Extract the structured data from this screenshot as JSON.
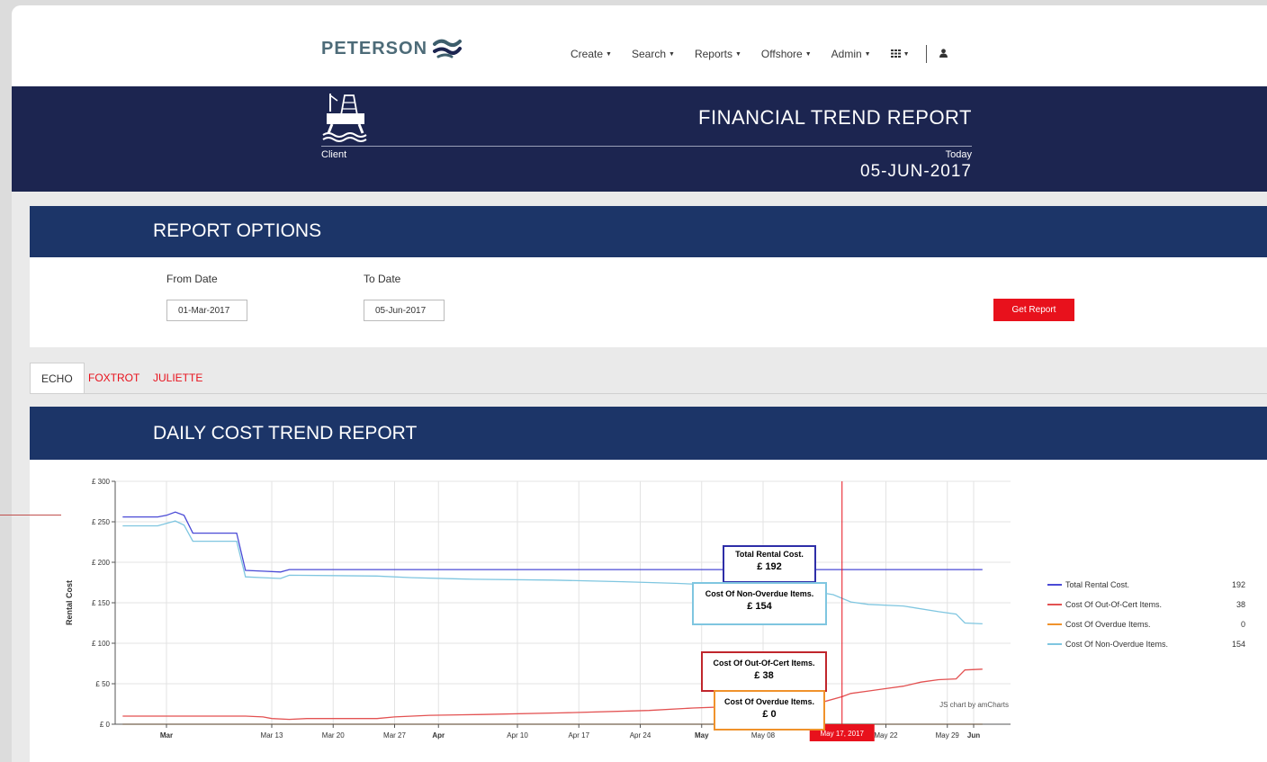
{
  "header": {
    "logo_text": "PETERSON",
    "nav": [
      {
        "label": "Create"
      },
      {
        "label": "Search"
      },
      {
        "label": "Reports"
      },
      {
        "label": "Offshore"
      },
      {
        "label": "Admin"
      }
    ]
  },
  "banner": {
    "client_label": "Client",
    "title": "FINANCIAL TREND REPORT",
    "today_label": "Today",
    "today_date": "05-JUN-2017"
  },
  "report_options": {
    "title": "REPORT OPTIONS",
    "from_label": "From Date",
    "from_value": "01-Mar-2017",
    "to_label": "To Date",
    "to_value": "05-Jun-2017",
    "button_label": "Get Report"
  },
  "tabs": [
    {
      "label": "ECHO",
      "active": true
    },
    {
      "label": "FOXTROT",
      "active": false
    },
    {
      "label": "JULIETTE",
      "active": false
    }
  ],
  "chart_section": {
    "title": "DAILY COST TREND REPORT",
    "credit": "JS chart by amCharts"
  },
  "tooltips": [
    {
      "label": "Total Rental Cost.",
      "value": "£ 192"
    },
    {
      "label": "Cost Of Non-Overdue Items.",
      "value": "£ 154"
    },
    {
      "label": "Cost Of Out-Of-Cert Items.",
      "value": "£ 38"
    },
    {
      "label": "Cost Of Overdue Items.",
      "value": "£ 0"
    }
  ],
  "chart_data": {
    "type": "line",
    "ylabel": "Rental Cost",
    "ylim": [
      0,
      300
    ],
    "yticks": [
      "£ 0",
      "£ 50",
      "£ 100",
      "£ 150",
      "£ 200",
      "£ 250",
      "£ 300"
    ],
    "xticks": [
      {
        "day": 0,
        "label": "Mar",
        "bold": true
      },
      {
        "day": 12,
        "label": "Mar 13",
        "bold": false
      },
      {
        "day": 19,
        "label": "Mar 20",
        "bold": false
      },
      {
        "day": 26,
        "label": "Mar 27",
        "bold": false
      },
      {
        "day": 31,
        "label": "Apr",
        "bold": true
      },
      {
        "day": 40,
        "label": "Apr 10",
        "bold": false
      },
      {
        "day": 47,
        "label": "Apr 17",
        "bold": false
      },
      {
        "day": 54,
        "label": "Apr 24",
        "bold": false
      },
      {
        "day": 61,
        "label": "May",
        "bold": true
      },
      {
        "day": 68,
        "label": "May 08",
        "bold": false
      },
      {
        "day": 82,
        "label": "May 22",
        "bold": false
      },
      {
        "day": 89,
        "label": "May 29",
        "bold": false
      },
      {
        "day": 92,
        "label": "Jun",
        "bold": true
      }
    ],
    "cursor": {
      "day": 77,
      "label": "May 17, 2017"
    },
    "grid": true,
    "legend_position": "right",
    "series": [
      {
        "name": "Total Rental Cost.",
        "color": "#4a4ad6",
        "legend_value": "192",
        "points": [
          [
            -5,
            256
          ],
          [
            -1,
            256
          ],
          [
            0,
            258
          ],
          [
            1,
            262
          ],
          [
            2,
            258
          ],
          [
            3,
            236
          ],
          [
            8,
            236
          ],
          [
            9,
            190
          ],
          [
            11,
            189
          ],
          [
            13,
            188
          ],
          [
            14,
            191
          ],
          [
            93,
            191
          ]
        ]
      },
      {
        "name": "Cost Of Out-Of-Cert Items.",
        "color": "#e35252",
        "legend_value": "38",
        "points": [
          [
            -5,
            10
          ],
          [
            9,
            10
          ],
          [
            11,
            9
          ],
          [
            12,
            7
          ],
          [
            14,
            6
          ],
          [
            16,
            7
          ],
          [
            24,
            7
          ],
          [
            26,
            9
          ],
          [
            30,
            11
          ],
          [
            36,
            12
          ],
          [
            45,
            14
          ],
          [
            55,
            17
          ],
          [
            60,
            20
          ],
          [
            65,
            22
          ],
          [
            70,
            25
          ],
          [
            75,
            28
          ],
          [
            77,
            34
          ],
          [
            78,
            38
          ],
          [
            80,
            41
          ],
          [
            82,
            44
          ],
          [
            84,
            47
          ],
          [
            86,
            52
          ],
          [
            88,
            55
          ],
          [
            90,
            56
          ],
          [
            91,
            67
          ],
          [
            93,
            68
          ]
        ]
      },
      {
        "name": "Cost Of Overdue Items.",
        "color": "#f0922b",
        "legend_value": "0",
        "points": [
          [
            -5,
            0
          ],
          [
            93,
            0
          ]
        ]
      },
      {
        "name": "Cost Of Non-Overdue Items.",
        "color": "#7fc6e0",
        "legend_value": "154",
        "points": [
          [
            -5,
            245
          ],
          [
            -1,
            245
          ],
          [
            0,
            248
          ],
          [
            1,
            251
          ],
          [
            2,
            246
          ],
          [
            3,
            226
          ],
          [
            8,
            226
          ],
          [
            9,
            182
          ],
          [
            11,
            181
          ],
          [
            13,
            180
          ],
          [
            14,
            184
          ],
          [
            24,
            183
          ],
          [
            28,
            181
          ],
          [
            35,
            179
          ],
          [
            44,
            178
          ],
          [
            52,
            176
          ],
          [
            58,
            174
          ],
          [
            65,
            171
          ],
          [
            72,
            167
          ],
          [
            76,
            160
          ],
          [
            78,
            151
          ],
          [
            80,
            148
          ],
          [
            84,
            146
          ],
          [
            88,
            139
          ],
          [
            90,
            136
          ],
          [
            91,
            125
          ],
          [
            93,
            124
          ]
        ]
      }
    ]
  }
}
